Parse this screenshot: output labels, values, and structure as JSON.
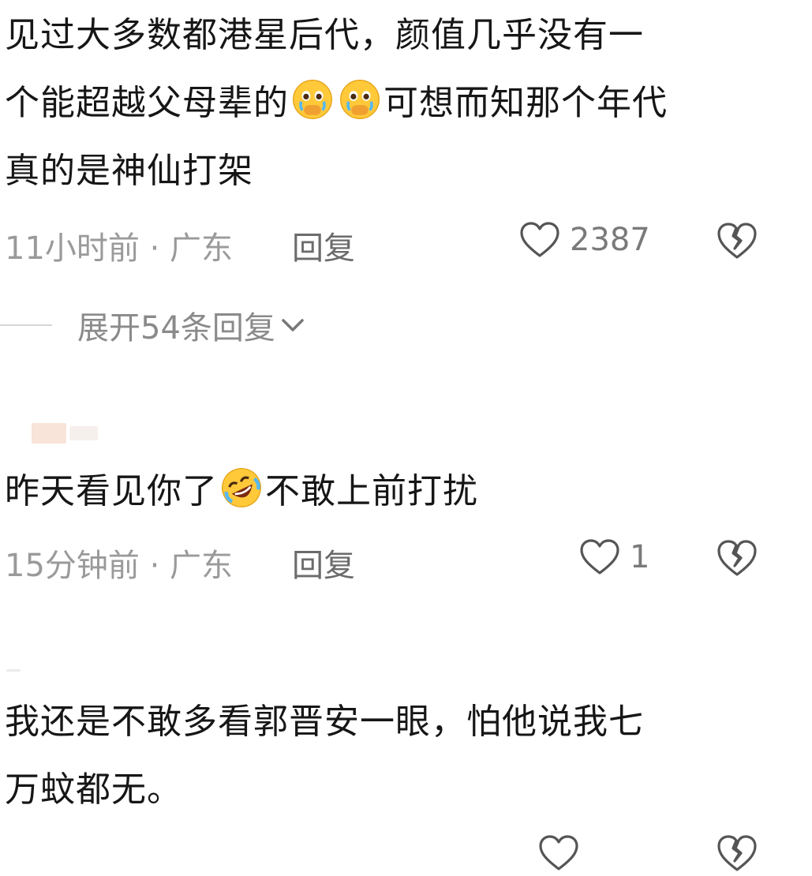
{
  "comments": [
    {
      "line1": "见过大多数都港星后代，颜值几乎没有一",
      "line2_before": "个能超越父母辈的",
      "line2_after": "可想而知那个年代",
      "line3": "真的是神仙打架",
      "emoji": "crying-face-emoji",
      "time": "11小时前 · 广东",
      "reply": "回复",
      "likes": "2387"
    },
    {
      "before": "昨天看见你了",
      "after": "不敢上前打扰",
      "emoji": "rolling-laughing-emoji",
      "time": "15分钟前 · 广东",
      "reply": "回复",
      "likes": "1"
    },
    {
      "line1": "我还是不敢多看郭晋安一眼，怕他说我七",
      "line2": "万蚊都无。"
    }
  ],
  "expand_replies": "展开54条回复",
  "icons": {
    "like": "heart-outline-icon",
    "dislike": "broken-heart-icon",
    "expand": "chevron-down-icon"
  }
}
